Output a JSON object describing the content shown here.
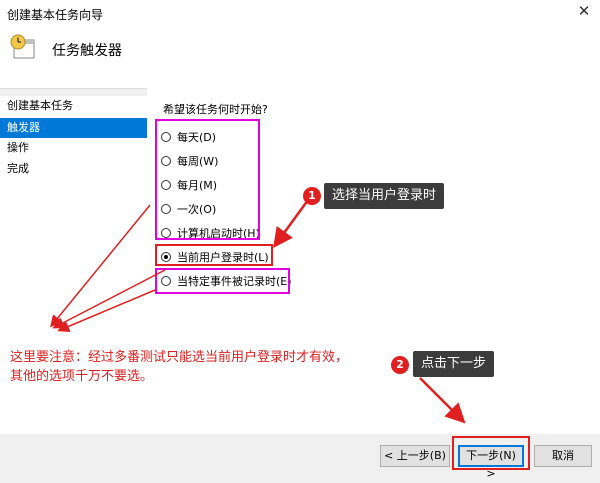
{
  "window": {
    "title": "创建基本任务向导",
    "close_label": "✕"
  },
  "header": {
    "heading": "任务触发器"
  },
  "sidebar": {
    "items": [
      {
        "label": "创建基本任务"
      },
      {
        "label": "触发器"
      },
      {
        "label": "操作"
      },
      {
        "label": "完成"
      }
    ]
  },
  "main": {
    "question": "希望该任务何时开始?",
    "options": [
      {
        "label": "每天(D)"
      },
      {
        "label": "每周(W)"
      },
      {
        "label": "每月(M)"
      },
      {
        "label": "一次(O)"
      },
      {
        "label": "计算机启动时(H)"
      },
      {
        "label": "当前用户登录时(L)"
      },
      {
        "label": "当特定事件被记录时(E)"
      }
    ],
    "selected_index": 5
  },
  "annotations": {
    "badge1": "1",
    "callout1": "选择当用户登录时",
    "badge2": "2",
    "callout2": "点击下一步",
    "note_line1": "这里要注意：经过多番测试只能选当前用户登录时才有效，",
    "note_line2": "其他的选项千万不要选。"
  },
  "footer": {
    "back_label": "< 上一步(B)",
    "next_label": "下一步(N) >",
    "cancel_label": "取消"
  },
  "colors": {
    "accent": "#0078d7",
    "highlight_red": "#e02020",
    "highlight_magenta": "#e000e0"
  }
}
